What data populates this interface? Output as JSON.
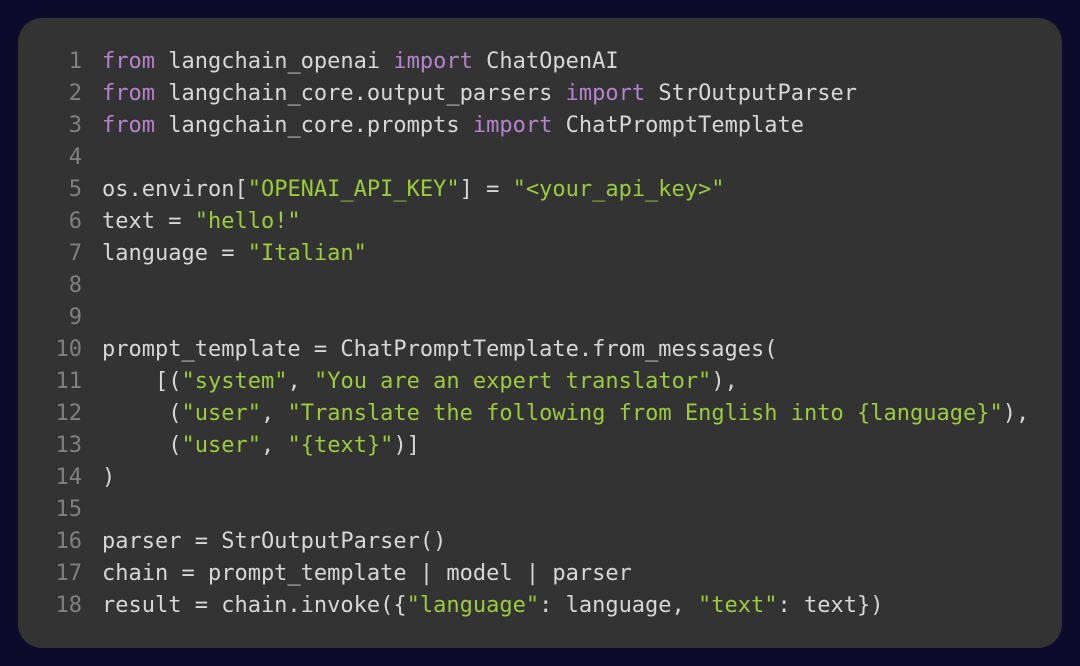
{
  "colors": {
    "background_outer": "#0d0b2b",
    "background_inner": "#333333",
    "text_default": "#d7d7d7",
    "keyword": "#b583cd",
    "string": "#9ccc3c",
    "gutter": "#808080"
  },
  "code": {
    "language": "python",
    "line_count": 18,
    "lines": [
      {
        "n": 1,
        "tokens": [
          [
            "kw",
            "from"
          ],
          [
            "sp",
            " "
          ],
          [
            "id",
            "langchain_openai"
          ],
          [
            "sp",
            " "
          ],
          [
            "kw",
            "import"
          ],
          [
            "sp",
            " "
          ],
          [
            "id",
            "ChatOpenAI"
          ]
        ]
      },
      {
        "n": 2,
        "tokens": [
          [
            "kw",
            "from"
          ],
          [
            "sp",
            " "
          ],
          [
            "id",
            "langchain_core.output_parsers"
          ],
          [
            "sp",
            " "
          ],
          [
            "kw",
            "import"
          ],
          [
            "sp",
            " "
          ],
          [
            "id",
            "StrOutputParser"
          ]
        ]
      },
      {
        "n": 3,
        "tokens": [
          [
            "kw",
            "from"
          ],
          [
            "sp",
            " "
          ],
          [
            "id",
            "langchain_core.prompts"
          ],
          [
            "sp",
            " "
          ],
          [
            "kw",
            "import"
          ],
          [
            "sp",
            " "
          ],
          [
            "id",
            "ChatPromptTemplate"
          ]
        ]
      },
      {
        "n": 4,
        "tokens": []
      },
      {
        "n": 5,
        "tokens": [
          [
            "id",
            "os.environ["
          ],
          [
            "str",
            "\"OPENAI_API_KEY\""
          ],
          [
            "id",
            "] = "
          ],
          [
            "str",
            "\"<your_api_key>\""
          ]
        ]
      },
      {
        "n": 6,
        "tokens": [
          [
            "id",
            "text = "
          ],
          [
            "str",
            "\"hello!\""
          ]
        ]
      },
      {
        "n": 7,
        "tokens": [
          [
            "id",
            "language = "
          ],
          [
            "str",
            "\"Italian\""
          ]
        ]
      },
      {
        "n": 8,
        "tokens": []
      },
      {
        "n": 9,
        "tokens": []
      },
      {
        "n": 10,
        "tokens": [
          [
            "id",
            "prompt_template = ChatPromptTemplate.from_messages("
          ]
        ]
      },
      {
        "n": 11,
        "tokens": [
          [
            "sp",
            "    "
          ],
          [
            "id",
            "[("
          ],
          [
            "str",
            "\"system\""
          ],
          [
            "id",
            ", "
          ],
          [
            "str",
            "\"You are an expert translator\""
          ],
          [
            "id",
            "),"
          ]
        ]
      },
      {
        "n": 12,
        "tokens": [
          [
            "sp",
            "     "
          ],
          [
            "id",
            "("
          ],
          [
            "str",
            "\"user\""
          ],
          [
            "id",
            ", "
          ],
          [
            "str",
            "\"Translate the following from English into {language}\""
          ],
          [
            "id",
            "),"
          ]
        ]
      },
      {
        "n": 13,
        "tokens": [
          [
            "sp",
            "     "
          ],
          [
            "id",
            "("
          ],
          [
            "str",
            "\"user\""
          ],
          [
            "id",
            ", "
          ],
          [
            "str",
            "\"{text}\""
          ],
          [
            "id",
            ")]"
          ]
        ]
      },
      {
        "n": 14,
        "tokens": [
          [
            "id",
            ")"
          ]
        ]
      },
      {
        "n": 15,
        "tokens": []
      },
      {
        "n": 16,
        "tokens": [
          [
            "id",
            "parser = StrOutputParser()"
          ]
        ]
      },
      {
        "n": 17,
        "tokens": [
          [
            "id",
            "chain = prompt_template | model | parser"
          ]
        ]
      },
      {
        "n": 18,
        "tokens": [
          [
            "id",
            "result = chain.invoke({"
          ],
          [
            "str",
            "\"language\""
          ],
          [
            "id",
            ": language, "
          ],
          [
            "str",
            "\"text\""
          ],
          [
            "id",
            ": text})"
          ]
        ]
      }
    ]
  }
}
